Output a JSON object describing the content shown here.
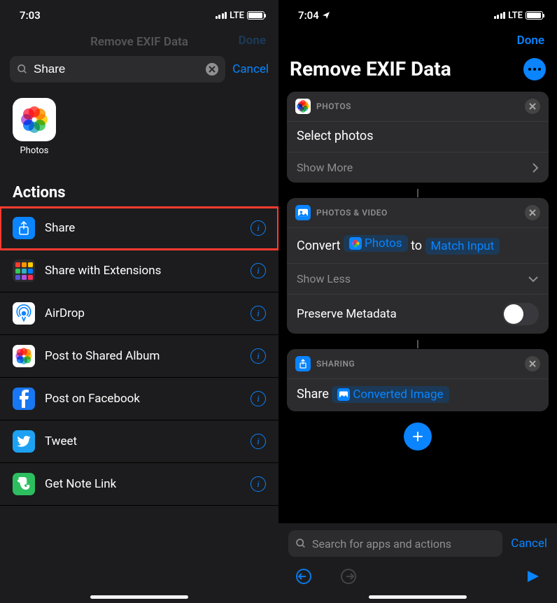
{
  "left": {
    "status": {
      "time": "7:03",
      "network": "LTE"
    },
    "dim_title": "Remove EXIF Data",
    "dim_done": "Done",
    "search": {
      "value": "Share",
      "cancel": "Cancel"
    },
    "app": {
      "name": "Photos"
    },
    "section": "Actions",
    "actions": [
      {
        "label": "Share"
      },
      {
        "label": "Share with Extensions"
      },
      {
        "label": "AirDrop"
      },
      {
        "label": "Post to Shared Album"
      },
      {
        "label": "Post on Facebook"
      },
      {
        "label": "Tweet"
      },
      {
        "label": "Get Note Link"
      }
    ]
  },
  "right": {
    "status": {
      "time": "7:04",
      "network": "LTE"
    },
    "done": "Done",
    "title": "Remove EXIF Data",
    "card1": {
      "category": "PHOTOS",
      "body": "Select photos",
      "show_more": "Show More"
    },
    "card2": {
      "category": "PHOTOS & VIDEO",
      "convert": "Convert",
      "photos_token": "Photos",
      "to": "to",
      "match_token": "Match Input",
      "show_less": "Show Less",
      "preserve": "Preserve Metadata"
    },
    "card3": {
      "category": "SHARING",
      "share": "Share",
      "converted_token": "Converted Image"
    },
    "bottom": {
      "search_placeholder": "Search for apps and actions",
      "cancel": "Cancel"
    }
  }
}
